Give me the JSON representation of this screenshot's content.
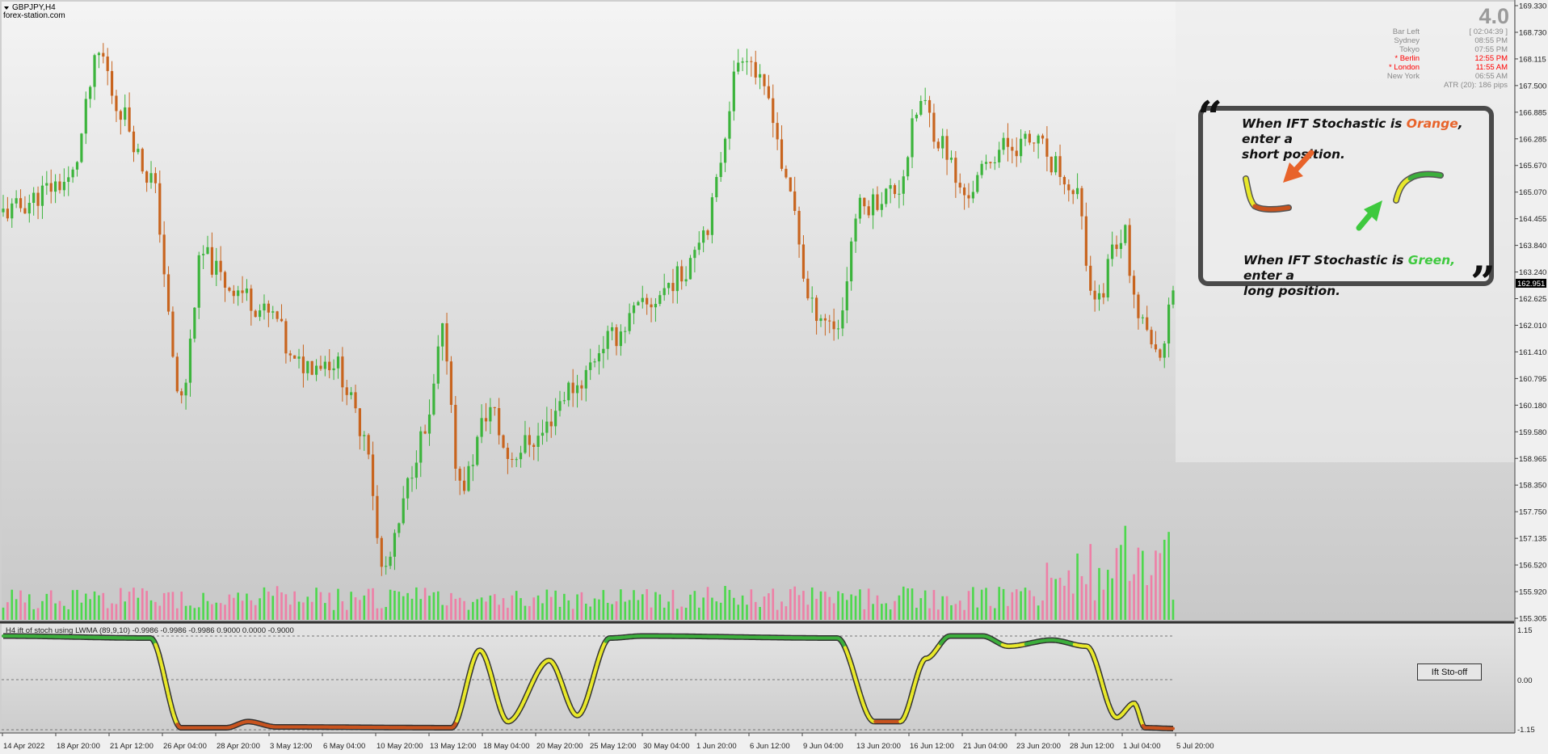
{
  "window": {
    "symbol": "GBPJPY,H4",
    "watermark": "forex-station.com"
  },
  "version": "4.0",
  "clock": {
    "rows": [
      {
        "label": "Bar Left",
        "value": "[ 02:04:39 ]",
        "color": "#8a8a8a"
      },
      {
        "label": "Sydney",
        "value": "08:55 PM",
        "color": "#8a8a8a"
      },
      {
        "label": "Tokyo",
        "value": "07:55 PM",
        "color": "#8a8a8a"
      },
      {
        "label": "* Berlin",
        "value": "12:55 PM",
        "color": "#ff0000"
      },
      {
        "label": "* London",
        "value": "11:55 AM",
        "color": "#ff0000"
      },
      {
        "label": "New York",
        "value": "06:55 AM",
        "color": "#8a8a8a"
      }
    ],
    "atr": "ATR (20): 186 pips"
  },
  "price_axis": {
    "labels": [
      "169.330",
      "168.730",
      "168.115",
      "167.500",
      "166.885",
      "166.285",
      "165.670",
      "165.070",
      "164.455",
      "163.840",
      "163.240",
      "162.625",
      "162.010",
      "161.410",
      "160.795",
      "160.180",
      "159.580",
      "158.965",
      "158.350",
      "157.750",
      "157.135",
      "156.520",
      "155.920",
      "155.305"
    ],
    "current_price": "162.951"
  },
  "indicator": {
    "title": "H4 ift of stoch using LWMA (89,9,10) -0.9986 -0.9986 -0.9986 0.9000 0.0000 -0.9000",
    "levels": [
      "1.15",
      "0.00",
      "-1.15"
    ],
    "button_label": "Ift Sto-off"
  },
  "time_axis": {
    "labels": [
      "14 Apr 2022",
      "18 Apr 20:00",
      "21 Apr 12:00",
      "26 Apr 04:00",
      "28 Apr 20:00",
      "3 May 12:00",
      "6 May 04:00",
      "10 May 20:00",
      "13 May 12:00",
      "18 May 04:00",
      "20 May 20:00",
      "25 May 12:00",
      "30 May 04:00",
      "1 Jun 20:00",
      "6 Jun 12:00",
      "9 Jun 04:00",
      "13 Jun 20:00",
      "16 Jun 12:00",
      "21 Jun 04:00",
      "23 Jun 20:00",
      "28 Jun 12:00",
      "1 Jul 04:00",
      "5 Jul 20:00"
    ]
  },
  "callout": {
    "short_prefix": "When IFT Stochastic is ",
    "short_color_word": "Orange",
    "short_suffix": ", enter a",
    "short_line2": "short position.",
    "long_prefix": "When IFT Stochastic is ",
    "long_color_word": "Green,",
    "long_suffix": " enter a",
    "long_line2": "long position.",
    "orange_hex": "#e8632a",
    "green_hex": "#3ec93e"
  },
  "colors": {
    "bull_candle": "#3cb43c",
    "bear_candle": "#c8641e",
    "volume_bull": "#4dd84d",
    "volume_bear": "#ee7fa6",
    "ift_up": "#3cae3c",
    "ift_mid": "#e8e82a",
    "ift_down": "#c8531e"
  },
  "chart_data": {
    "type": "candlestick",
    "timeframe": "H4",
    "close_path_anchors": [
      {
        "t": 0,
        "p": 164.6
      },
      {
        "t": 3,
        "p": 165.3
      },
      {
        "t": 4.5,
        "p": 168.2
      },
      {
        "t": 5.3,
        "p": 167.0
      },
      {
        "t": 6.8,
        "p": 165.4
      },
      {
        "t": 8.2,
        "p": 160.3
      },
      {
        "t": 9.2,
        "p": 163.6
      },
      {
        "t": 10.5,
        "p": 162.9
      },
      {
        "t": 12.5,
        "p": 162.2
      },
      {
        "t": 13.4,
        "p": 161.1
      },
      {
        "t": 15.2,
        "p": 161.2
      },
      {
        "t": 16.7,
        "p": 159.6
      },
      {
        "t": 17.5,
        "p": 156.4
      },
      {
        "t": 19.5,
        "p": 159.5
      },
      {
        "t": 20.3,
        "p": 161.8
      },
      {
        "t": 21.1,
        "p": 158.3
      },
      {
        "t": 22.5,
        "p": 160.1
      },
      {
        "t": 23.3,
        "p": 159.0
      },
      {
        "t": 24.5,
        "p": 159.4
      },
      {
        "t": 26.3,
        "p": 160.6
      },
      {
        "t": 28.0,
        "p": 161.7
      },
      {
        "t": 29.5,
        "p": 162.4
      },
      {
        "t": 31.2,
        "p": 163.1
      },
      {
        "t": 32.3,
        "p": 164.2
      },
      {
        "t": 34.2,
        "p": 168.3
      },
      {
        "t": 35.3,
        "p": 167.2
      },
      {
        "t": 36.3,
        "p": 165.0
      },
      {
        "t": 37.3,
        "p": 162.4
      },
      {
        "t": 38.5,
        "p": 162.0
      },
      {
        "t": 39.5,
        "p": 164.7
      },
      {
        "t": 41.2,
        "p": 165.1
      },
      {
        "t": 42.4,
        "p": 167.1
      },
      {
        "t": 43.3,
        "p": 166.2
      },
      {
        "t": 44.3,
        "p": 165.0
      },
      {
        "t": 46.2,
        "p": 166.1
      },
      {
        "t": 47.5,
        "p": 166.2
      },
      {
        "t": 49.6,
        "p": 165.1
      },
      {
        "t": 50.3,
        "p": 162.4
      },
      {
        "t": 51.7,
        "p": 164.2
      },
      {
        "t": 52.4,
        "p": 162.0
      },
      {
        "t": 53.4,
        "p": 161.2
      },
      {
        "t": 54.0,
        "p": 162.9
      }
    ],
    "ift_path_anchors": [
      {
        "t": 0,
        "v": 1.15
      },
      {
        "t": 6.8,
        "v": 1.1
      },
      {
        "t": 8.2,
        "v": -1.1
      },
      {
        "t": 10.3,
        "v": -1.1
      },
      {
        "t": 11.3,
        "v": -0.95
      },
      {
        "t": 12.6,
        "v": -1.08
      },
      {
        "t": 20.7,
        "v": -1.1
      },
      {
        "t": 22.0,
        "v": 0.8
      },
      {
        "t": 23.3,
        "v": -0.95
      },
      {
        "t": 25.2,
        "v": 0.55
      },
      {
        "t": 26.5,
        "v": -0.8
      },
      {
        "t": 28.0,
        "v": 1.1
      },
      {
        "t": 29.5,
        "v": 1.15
      },
      {
        "t": 38.5,
        "v": 1.1
      },
      {
        "t": 40.2,
        "v": -0.95
      },
      {
        "t": 41.4,
        "v": -0.95
      },
      {
        "t": 42.6,
        "v": 0.6
      },
      {
        "t": 43.7,
        "v": 1.15
      },
      {
        "t": 45.2,
        "v": 1.15
      },
      {
        "t": 46.4,
        "v": 0.9
      },
      {
        "t": 48.4,
        "v": 1.05
      },
      {
        "t": 50.0,
        "v": 0.9
      },
      {
        "t": 51.4,
        "v": -0.85
      },
      {
        "t": 52.2,
        "v": -0.5
      },
      {
        "t": 52.7,
        "v": -1.1
      },
      {
        "t": 54.0,
        "v": -1.12
      }
    ],
    "price_range": [
      155.305,
      169.33
    ],
    "ift_range": [
      -1.15,
      1.15
    ]
  }
}
